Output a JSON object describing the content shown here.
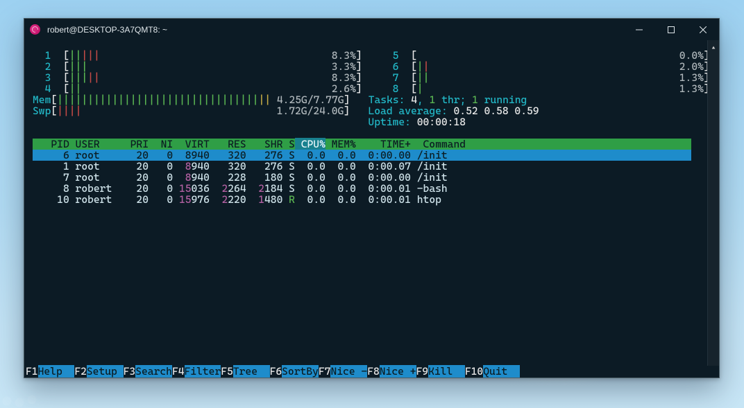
{
  "window": {
    "title": "robert@DESKTOP-3A7QMT8: ~"
  },
  "cpus": [
    {
      "id": "1",
      "bars": "|||||",
      "colors": [
        "g",
        "g",
        "r",
        "r",
        "r"
      ],
      "pct": "8.3%"
    },
    {
      "id": "2",
      "bars": "|||",
      "colors": [
        "g",
        "g",
        "g"
      ],
      "pct": "3.3%"
    },
    {
      "id": "3",
      "bars": "|||||",
      "colors": [
        "g",
        "g",
        "g",
        "r",
        "r"
      ],
      "pct": "8.3%"
    },
    {
      "id": "4",
      "bars": "||",
      "colors": [
        "g",
        "g"
      ],
      "pct": "2.6%"
    },
    {
      "id": "5",
      "bars": "",
      "colors": [],
      "pct": "0.0%"
    },
    {
      "id": "6",
      "bars": "||",
      "colors": [
        "g",
        "r"
      ],
      "pct": "2.0%"
    },
    {
      "id": "7",
      "bars": "||",
      "colors": [
        "g",
        "g"
      ],
      "pct": "1.3%"
    },
    {
      "id": "8",
      "bars": "|",
      "colors": [
        "g"
      ],
      "pct": "1.3%"
    }
  ],
  "mem": {
    "label": "Mem",
    "value": "4.25G/7.77G",
    "bars": 33,
    "warn": 2
  },
  "swp": {
    "label": "Swp",
    "value": "1.72G/24.0G",
    "bars": 4
  },
  "tasks_lead": "Tasks: ",
  "tasks_total": "4",
  "tasks_mid": ", ",
  "tasks_thr": "1",
  "tasks_threads_lbl": " thr",
  "tasks_sep": "; ",
  "tasks_run": "1",
  "tasks_running_lbl": " running",
  "load_label": "Load average: ",
  "load": [
    "0.52",
    "0.58",
    "0.59"
  ],
  "uptime_label": "Uptime: ",
  "uptime": "00:00:18",
  "columns": [
    "PID",
    "USER",
    "PRI",
    "NI",
    "VIRT",
    "RES",
    "SHR",
    "S",
    "CPU%",
    "MEM%",
    "TIME+",
    "Command"
  ],
  "sort_col": "CPU%",
  "procs": [
    {
      "pid": "6",
      "user": "root",
      "pri": "20",
      "ni": "0",
      "virt": "8940",
      "v_hi": "8",
      "res": "320",
      "r_hi": "",
      "shr": "276",
      "s_hi": "",
      "s": "S",
      "cpu": "0.0",
      "mem": "0.0",
      "time": "0:00.00",
      "cmd": "/init",
      "sel": true
    },
    {
      "pid": "1",
      "user": "root",
      "pri": "20",
      "ni": "0",
      "virt": "8940",
      "v_hi": "8",
      "res": "320",
      "r_hi": "",
      "shr": "276",
      "s_hi": "",
      "s": "S",
      "cpu": "0.0",
      "mem": "0.0",
      "time": "0:00.07",
      "cmd": "/init",
      "sel": false
    },
    {
      "pid": "7",
      "user": "root",
      "pri": "20",
      "ni": "0",
      "virt": "8940",
      "v_hi": "8",
      "res": "228",
      "r_hi": "",
      "shr": "180",
      "s_hi": "",
      "s": "S",
      "cpu": "0.0",
      "mem": "0.0",
      "time": "0:00.00",
      "cmd": "/init",
      "sel": false
    },
    {
      "pid": "8",
      "user": "robert",
      "pri": "20",
      "ni": "0",
      "virt": "15036",
      "v_hi": "15",
      "res": "2264",
      "r_hi": "2",
      "shr": "2184",
      "s_hi": "2",
      "s": "S",
      "cpu": "0.0",
      "mem": "0.0",
      "time": "0:00.01",
      "cmd": "-bash",
      "sel": false
    },
    {
      "pid": "10",
      "user": "robert",
      "pri": "20",
      "ni": "0",
      "virt": "15976",
      "v_hi": "15",
      "res": "2220",
      "r_hi": "2",
      "shr": "1480",
      "s_hi": "1",
      "s": "R",
      "cpu": "0.0",
      "mem": "0.0",
      "time": "0:00.01",
      "cmd": "htop",
      "sel": false
    }
  ],
  "fkeys": [
    {
      "k": "F1",
      "l": "Help  "
    },
    {
      "k": "F2",
      "l": "Setup "
    },
    {
      "k": "F3",
      "l": "Search"
    },
    {
      "k": "F4",
      "l": "Filter"
    },
    {
      "k": "F5",
      "l": "Tree  "
    },
    {
      "k": "F6",
      "l": "SortBy"
    },
    {
      "k": "F7",
      "l": "Nice -"
    },
    {
      "k": "F8",
      "l": "Nice +"
    },
    {
      "k": "F9",
      "l": "Kill  "
    },
    {
      "k": "F10",
      "l": "Quit  "
    }
  ]
}
